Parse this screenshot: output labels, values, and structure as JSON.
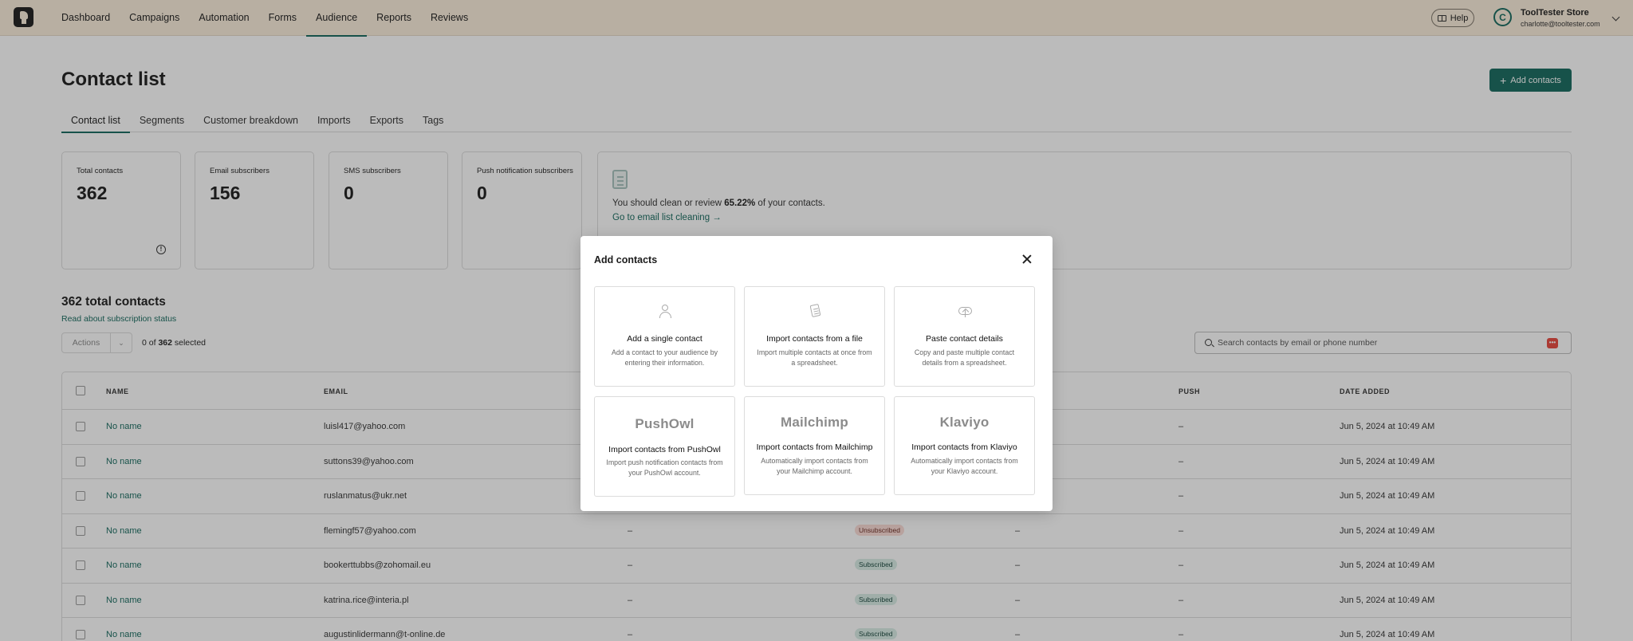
{
  "nav": {
    "items": [
      "Dashboard",
      "Campaigns",
      "Automation",
      "Forms",
      "Audience",
      "Reports",
      "Reviews"
    ],
    "active": "Audience",
    "help_label": "Help",
    "avatar_initial": "C",
    "store_name": "ToolTester Store",
    "store_email": "charlotte@tooltester.com"
  },
  "page": {
    "title": "Contact list",
    "add_button": "Add contacts",
    "tabs": [
      "Contact list",
      "Segments",
      "Customer breakdown",
      "Imports",
      "Exports",
      "Tags"
    ],
    "active_tab": "Contact list"
  },
  "stats": [
    {
      "label": "Total contacts",
      "value": "362"
    },
    {
      "label": "Email subscribers",
      "value": "156"
    },
    {
      "label": "SMS subscribers",
      "value": "0"
    },
    {
      "label": "Push notification subscribers",
      "value": "0"
    }
  ],
  "cleaning": {
    "text_before": "You should clean or review ",
    "percent": "65.22%",
    "text_after": " of your contacts.",
    "link": "Go to email list cleaning →"
  },
  "list": {
    "heading": "362 total contacts",
    "sub_link": "Read about subscription status",
    "actions_label": "Actions",
    "selected_prefix": "0 of ",
    "selected_count": "362",
    "selected_suffix": " selected",
    "search_placeholder": "Search contacts by email or phone number"
  },
  "table": {
    "headers": {
      "name": "NAME",
      "email": "EMAIL",
      "push": "PUSH",
      "date": "DATE ADDED"
    },
    "rows": [
      {
        "name": "No name",
        "email": "luisl417@yahoo.com",
        "phone": "",
        "status": "",
        "sms": "",
        "push": "–",
        "date": "Jun 5, 2024 at 10:49 AM"
      },
      {
        "name": "No name",
        "email": "suttons39@yahoo.com",
        "phone": "",
        "status": "",
        "sms": "",
        "push": "–",
        "date": "Jun 5, 2024 at 10:49 AM"
      },
      {
        "name": "No name",
        "email": "ruslanmatus@ukr.net",
        "phone": "",
        "status": "",
        "sms": "",
        "push": "–",
        "date": "Jun 5, 2024 at 10:49 AM"
      },
      {
        "name": "No name",
        "email": "flemingf57@yahoo.com",
        "phone": "–",
        "status": "Unsubscribed",
        "sms": "–",
        "push": "–",
        "date": "Jun 5, 2024 at 10:49 AM"
      },
      {
        "name": "No name",
        "email": "bookerttubbs@zohomail.eu",
        "phone": "–",
        "status": "Subscribed",
        "sms": "–",
        "push": "–",
        "date": "Jun 5, 2024 at 10:49 AM"
      },
      {
        "name": "No name",
        "email": "katrina.rice@interia.pl",
        "phone": "–",
        "status": "Subscribed",
        "sms": "–",
        "push": "–",
        "date": "Jun 5, 2024 at 10:49 AM"
      },
      {
        "name": "No name",
        "email": "augustinlidermann@t-online.de",
        "phone": "–",
        "status": "Subscribed",
        "sms": "–",
        "push": "–",
        "date": "Jun 5, 2024 at 10:49 AM"
      }
    ]
  },
  "modal": {
    "title": "Add contacts",
    "options": [
      {
        "title": "Add a single contact",
        "desc": "Add a contact to your audience by entering their information.",
        "icon": "person-icon"
      },
      {
        "title": "Import contacts from a file",
        "desc": "Import multiple contacts at once from a spreadsheet.",
        "icon": "file-icon"
      },
      {
        "title": "Paste contact details",
        "desc": "Copy and paste multiple contact details from a spreadsheet.",
        "icon": "cloud-upload-icon"
      },
      {
        "brand": "PushOwl",
        "title": "Import contacts from PushOwl",
        "desc": "Import push notification contacts from your PushOwl account."
      },
      {
        "brand": "Mailchimp",
        "title": "Import contacts from Mailchimp",
        "desc": "Automatically import contacts from your Mailchimp account."
      },
      {
        "brand": "Klaviyo",
        "title": "Import contacts from Klaviyo",
        "desc": "Automatically import contacts from your Klaviyo account."
      }
    ]
  },
  "colors": {
    "accent": "#15695d",
    "nav_bg": "#fbeedb",
    "subscribed_bg": "#d9ede6",
    "unsubscribed_bg": "#fbdcd6"
  }
}
